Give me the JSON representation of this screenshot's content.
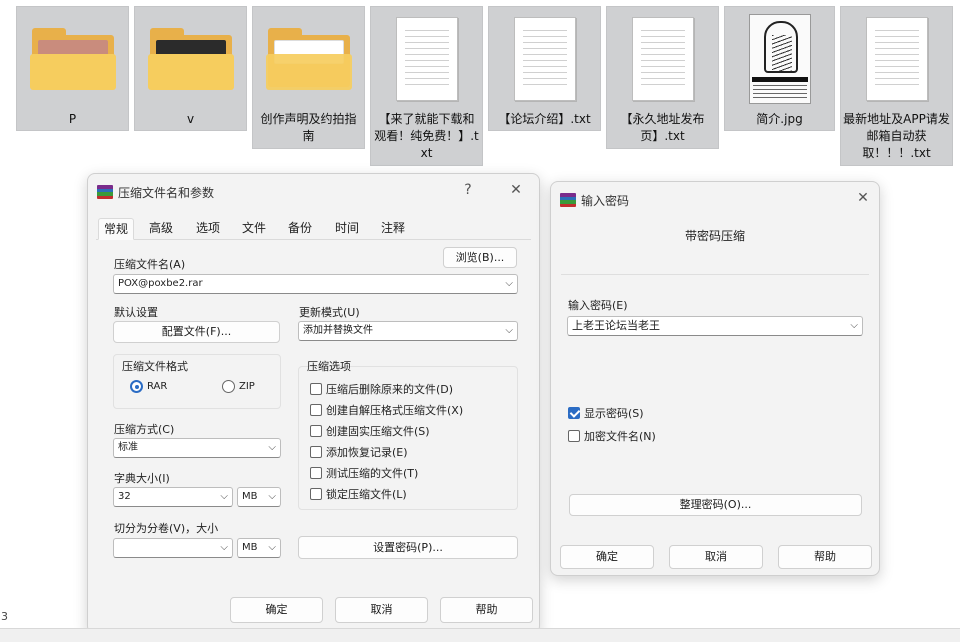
{
  "files": [
    {
      "name": "P",
      "kind": "folder",
      "photo_color": "#c98c7d"
    },
    {
      "name": "v",
      "kind": "folder",
      "photo_color": "#2b2b2b"
    },
    {
      "name": "创作声明及约拍指南",
      "kind": "folder-doc"
    },
    {
      "name": "【来了就能下载和观看！纯免费！】.txt",
      "kind": "txt"
    },
    {
      "name": "【论坛介绍】.txt",
      "kind": "txt"
    },
    {
      "name": "【永久地址发布页】.txt",
      "kind": "txt"
    },
    {
      "name": "简介.jpg",
      "kind": "image"
    },
    {
      "name": "最新地址及APP请发邮箱自动获取！！！.txt",
      "kind": "txt"
    }
  ],
  "archive_dialog": {
    "title": "压缩文件名和参数",
    "help_glyph": "?",
    "close_glyph": "✕",
    "tabs": [
      "常规",
      "高级",
      "选项",
      "文件",
      "备份",
      "时间",
      "注释"
    ],
    "active_tab": "常规",
    "archive_name_label": "压缩文件名(A)",
    "browse_button": "浏览(B)...",
    "archive_name_value": "POX@poxbe2.rar",
    "default_profile_label": "默认设置",
    "profile_button": "配置文件(F)...",
    "update_mode_label": "更新模式(U)",
    "update_mode_value": "添加并替换文件",
    "format_group_label": "压缩文件格式",
    "format_rar": "RAR",
    "format_zip": "ZIP",
    "format_selected": "RAR",
    "options_group_label": "压缩选项",
    "options": [
      {
        "label": "压缩后删除原来的文件(D)",
        "checked": false
      },
      {
        "label": "创建自解压格式压缩文件(X)",
        "checked": false
      },
      {
        "label": "创建固实压缩文件(S)",
        "checked": false
      },
      {
        "label": "添加恢复记录(E)",
        "checked": false
      },
      {
        "label": "测试压缩的文件(T)",
        "checked": false
      },
      {
        "label": "锁定压缩文件(L)",
        "checked": false
      }
    ],
    "method_label": "压缩方式(C)",
    "method_value": "标准",
    "dict_label": "字典大小(I)",
    "dict_value": "32",
    "dict_unit": "MB",
    "split_label": "切分为分卷(V)，大小",
    "split_value": "",
    "split_unit": "MB",
    "set_password_button": "设置密码(P)...",
    "ok_button": "确定",
    "cancel_button": "取消",
    "help_button": "帮助"
  },
  "password_dialog": {
    "title": "输入密码",
    "close_glyph": "✕",
    "heading": "带密码压缩",
    "password_label": "输入密码(E)",
    "password_value": "上老王论坛当老王",
    "show_password_label": "显示密码(S)",
    "show_password_checked": true,
    "encrypt_names_label": "加密文件名(N)",
    "encrypt_names_checked": false,
    "organize_button": "整理密码(O)...",
    "ok_button": "确定",
    "cancel_button": "取消",
    "help_button": "帮助"
  },
  "edge_text": "3",
  "colors": {
    "accent": "#2b6cc4",
    "folder": "#e8b04a",
    "tile_bg": "#cfd0d2",
    "dialog_bg": "#f3f3f3"
  }
}
